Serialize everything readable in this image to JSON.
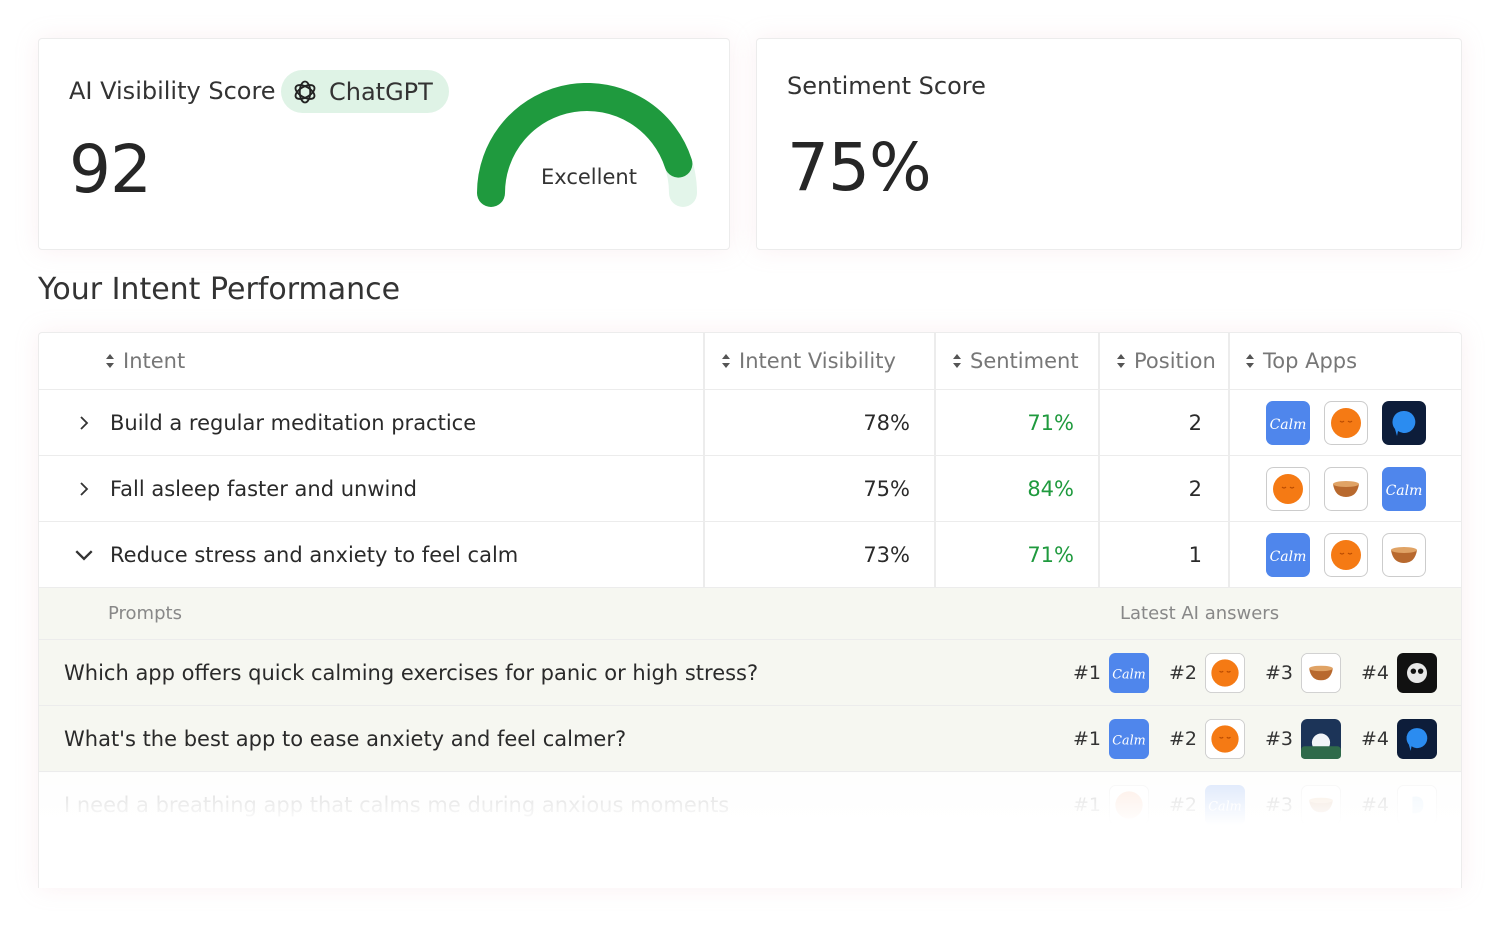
{
  "visibility_card": {
    "title": "AI Visibility Score",
    "engine": "ChatGPT",
    "score": "92",
    "score_value": 92,
    "rating": "Excellent",
    "gauge_color": "#1f9a3e",
    "gauge_track_color": "#e3f5ea"
  },
  "sentiment_card": {
    "title": "Sentiment Score",
    "score": "75%"
  },
  "section_title": "Your Intent Performance",
  "table": {
    "headers": {
      "intent": "Intent",
      "visibility": "Intent Visibility",
      "sentiment": "Sentiment",
      "position": "Position",
      "top_apps": "Top Apps"
    },
    "rows": [
      {
        "intent": "Build a regular meditation practice",
        "visibility": "78%",
        "sentiment": "71%",
        "position": "2",
        "expanded": false,
        "apps": [
          "calm",
          "headspace",
          "meditation-helper"
        ]
      },
      {
        "intent": "Fall asleep faster and unwind",
        "visibility": "75%",
        "sentiment": "84%",
        "position": "2",
        "expanded": false,
        "apps": [
          "headspace",
          "singing-bowl",
          "calm"
        ]
      },
      {
        "intent": "Reduce stress and anxiety to feel calm",
        "visibility": "73%",
        "sentiment": "71%",
        "position": "1",
        "expanded": true,
        "apps": [
          "calm",
          "headspace",
          "singing-bowl"
        ]
      }
    ],
    "sub_headers": {
      "prompts": "Prompts",
      "answers": "Latest AI answers"
    },
    "prompts": [
      {
        "text": "Which app offers quick calming exercises for panic or high stress?",
        "ranks": [
          {
            "label": "#1",
            "app": "calm"
          },
          {
            "label": "#2",
            "app": "headspace"
          },
          {
            "label": "#3",
            "app": "singing-bowl"
          },
          {
            "label": "#4",
            "app": "panda-night"
          }
        ]
      },
      {
        "text": "What's the best app to ease anxiety and feel calmer?",
        "ranks": [
          {
            "label": "#1",
            "app": "calm"
          },
          {
            "label": "#2",
            "app": "headspace"
          },
          {
            "label": "#3",
            "app": "moon-landscape"
          },
          {
            "label": "#4",
            "app": "meditation-helper"
          }
        ]
      },
      {
        "text": "I need a breathing app that calms me during anxious moments",
        "ranks": [
          {
            "label": "#1",
            "app": "headspace-peach"
          },
          {
            "label": "#2",
            "app": "calm"
          },
          {
            "label": "#3",
            "app": "singing-bowl"
          },
          {
            "label": "#4",
            "app": "breathe-blue"
          }
        ]
      }
    ]
  },
  "colors": {
    "green": "#1f9a3e",
    "chip_bg": "#dff3e6",
    "prompt_bg": "#f6f7f1"
  },
  "app_icons": {
    "calm": "Calm",
    "headspace": "",
    "headspace-peach": "",
    "singing-bowl": "",
    "meditation-helper": "",
    "panda-night": "",
    "moon-landscape": "",
    "breathe-blue": ""
  }
}
